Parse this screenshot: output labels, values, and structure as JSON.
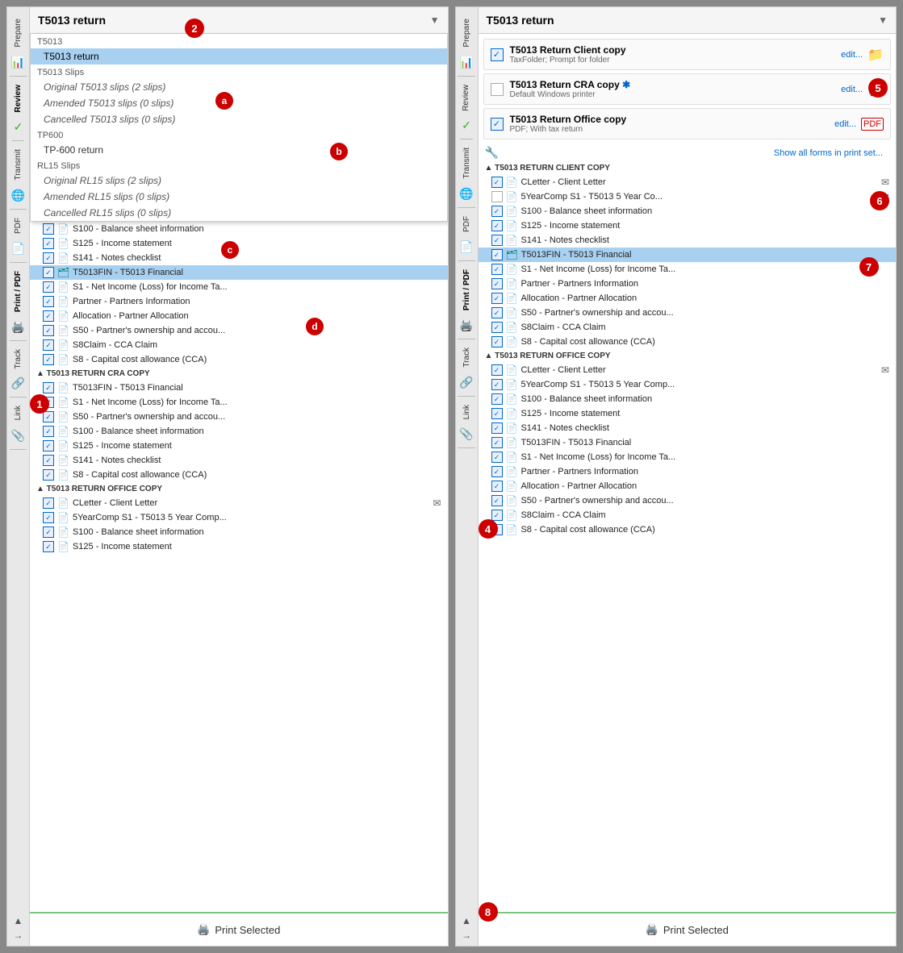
{
  "left_panel": {
    "title": "T5013 return",
    "dropdown_open": true,
    "dropdown_items": [
      {
        "type": "section",
        "label": "T5013"
      },
      {
        "type": "item",
        "label": "T5013 return",
        "selected": true,
        "badge": "a"
      },
      {
        "type": "section",
        "label": "T5013 Slips"
      },
      {
        "type": "item",
        "label": "Original T5013 slips (2 slips)",
        "italic": true,
        "badge": "b"
      },
      {
        "type": "item",
        "label": "Amended T5013 slips (0 slips)",
        "italic": true
      },
      {
        "type": "item",
        "label": "Cancelled T5013 slips (0 slips)",
        "italic": true
      },
      {
        "type": "section",
        "label": "TP600"
      },
      {
        "type": "item",
        "label": "TP-600 return",
        "badge": "c"
      },
      {
        "type": "section",
        "label": "RL15 Slips"
      },
      {
        "type": "item",
        "label": "Original RL15 slips (2 slips)",
        "italic": true,
        "badge": "d"
      },
      {
        "type": "item",
        "label": "Amended RL15 slips (0 slips)",
        "italic": true
      },
      {
        "type": "item",
        "label": "Cancelled RL15 slips (0 slips)",
        "italic": true
      }
    ],
    "tree_items_before_dropdown": [
      {
        "label": "S100 - Balance sheet information",
        "checked": true,
        "icon": "doc"
      },
      {
        "label": "S125 - Income statement",
        "checked": true,
        "icon": "doc"
      },
      {
        "label": "S141 - Notes checklist",
        "checked": true,
        "icon": "doc"
      },
      {
        "label": "T5013FIN - T5013 Financial",
        "checked": true,
        "icon": "doc-teal",
        "highlighted": true
      },
      {
        "label": "S1 - Net Income (Loss) for Income Ta...",
        "checked": true,
        "icon": "doc"
      },
      {
        "label": "Partner - Partners Information",
        "checked": true,
        "icon": "doc"
      },
      {
        "label": "Allocation - Partner Allocation",
        "checked": true,
        "icon": "doc"
      },
      {
        "label": "S50 - Partner's ownership and accou...",
        "checked": true,
        "icon": "doc"
      },
      {
        "label": "S8Claim - CCA Claim",
        "checked": true,
        "icon": "doc"
      },
      {
        "label": "S8 - Capital cost allowance (CCA)",
        "checked": true,
        "icon": "doc-purple"
      }
    ],
    "cra_copy_items": [
      {
        "label": "T5013FIN - T5013 Financial",
        "checked": true,
        "icon": "doc"
      },
      {
        "label": "S1 - Net Income (Loss) for Income Ta...",
        "checked": true,
        "icon": "doc"
      },
      {
        "label": "S50 - Partner's ownership and accou...",
        "checked": true,
        "icon": "doc"
      },
      {
        "label": "S100 - Balance sheet information",
        "checked": true,
        "icon": "doc"
      },
      {
        "label": "S125 - Income statement",
        "checked": true,
        "icon": "doc"
      },
      {
        "label": "S141 - Notes checklist",
        "checked": true,
        "icon": "doc"
      },
      {
        "label": "S8 - Capital cost allowance (CCA)",
        "checked": true,
        "icon": "doc-purple"
      }
    ],
    "office_copy_items": [
      {
        "label": "CLetter - Client Letter",
        "checked": true,
        "icon": "doc",
        "mail": true
      },
      {
        "label": "5YearComp S1 - T5013 5 Year Comp...",
        "checked": true,
        "icon": "doc-purple"
      },
      {
        "label": "S100 - Balance sheet information",
        "checked": true,
        "icon": "doc"
      },
      {
        "label": "S125 - Income statement",
        "checked": true,
        "icon": "doc"
      }
    ],
    "section_cra": "▲ T5013 RETURN CRA COPY",
    "section_office": "▲ T5013 RETURN OFFICE COPY",
    "print_button": "Print Selected",
    "badge_number": "1"
  },
  "right_panel": {
    "title": "T5013 return",
    "print_options": [
      {
        "label": "T5013 Return Client copy",
        "subtitle": "TaxFolder; Prompt for folder",
        "checked": true,
        "action": "folder",
        "edit_link": "edit..."
      },
      {
        "label": "T5013 Return CRA copy",
        "subtitle": "Default Windows printer",
        "checked": false,
        "action": "printer",
        "edit_link": "edit...",
        "asterisk": true
      },
      {
        "label": "T5013 Return Office copy",
        "subtitle": "PDF; With tax return",
        "checked": true,
        "action": "pdf",
        "edit_link": "edit..."
      }
    ],
    "show_forms_link": "Show all forms in print set...",
    "section_client": "▲ T5013 RETURN CLIENT COPY",
    "client_items": [
      {
        "label": "CLetter - Client Letter",
        "checked": true,
        "icon": "doc",
        "mail": true
      },
      {
        "label": "5YearComp S1 - T5013 5 Year Co...",
        "checked": false,
        "icon": "doc",
        "asterisk": true
      },
      {
        "label": "S100 - Balance sheet information",
        "checked": true,
        "icon": "doc"
      },
      {
        "label": "S125 - Income statement",
        "checked": true,
        "icon": "doc"
      },
      {
        "label": "S141 - Notes checklist",
        "checked": true,
        "icon": "doc"
      },
      {
        "label": "T5013FIN - T5013 Financial",
        "checked": true,
        "icon": "doc-teal",
        "highlighted": true
      },
      {
        "label": "S1 - Net Income (Loss) for Income Ta...",
        "checked": true,
        "icon": "doc"
      },
      {
        "label": "Partner - Partners Information",
        "checked": true,
        "icon": "doc"
      },
      {
        "label": "Allocation - Partner Allocation",
        "checked": true,
        "icon": "doc"
      },
      {
        "label": "S50 - Partner's ownership and accou...",
        "checked": true,
        "icon": "doc"
      },
      {
        "label": "S8Claim - CCA Claim",
        "checked": true,
        "icon": "doc"
      },
      {
        "label": "S8 - Capital cost allowance (CCA)",
        "checked": true,
        "icon": "doc-purple"
      }
    ],
    "section_office": "▲ T5013 RETURN OFFICE COPY",
    "office_items": [
      {
        "label": "CLetter - Client Letter",
        "checked": true,
        "icon": "doc",
        "mail": true
      },
      {
        "label": "5YearComp S1 - T5013 5 Year Comp...",
        "checked": true,
        "icon": "doc-purple"
      },
      {
        "label": "S100 - Balance sheet information",
        "checked": true,
        "icon": "doc"
      },
      {
        "label": "S125 - Income statement",
        "checked": true,
        "icon": "doc"
      },
      {
        "label": "S141 - Notes checklist",
        "checked": true,
        "icon": "doc"
      },
      {
        "label": "T5013FIN - T5013 Financial",
        "checked": true,
        "icon": "doc"
      },
      {
        "label": "S1 - Net Income (Loss) for Income Ta...",
        "checked": true,
        "icon": "doc"
      },
      {
        "label": "Partner - Partners Information",
        "checked": true,
        "icon": "doc"
      },
      {
        "label": "Allocation - Partner Allocation",
        "checked": true,
        "icon": "doc"
      },
      {
        "label": "S50 - Partner's ownership and accou...",
        "checked": true,
        "icon": "doc"
      },
      {
        "label": "S8Claim - CCA Claim",
        "checked": true,
        "icon": "doc"
      },
      {
        "label": "S8 - Capital cost allowance (CCA)",
        "checked": true,
        "icon": "doc-purple"
      }
    ],
    "print_button": "Print Selected",
    "badge_number": "8"
  },
  "sidebar_tabs": [
    {
      "label": "Prepare",
      "active": false
    },
    {
      "label": "Review",
      "active": false
    },
    {
      "label": "Transmit",
      "active": false
    },
    {
      "label": "PDF",
      "active": false
    },
    {
      "label": "Print / PDF",
      "active": true
    },
    {
      "label": "Track",
      "active": false
    },
    {
      "label": "Link",
      "active": false
    }
  ],
  "colors": {
    "highlight_blue": "#a8d0f0",
    "accent_green": "#7dc47d",
    "badge_red": "#cc0000",
    "link_blue": "#0066cc"
  }
}
